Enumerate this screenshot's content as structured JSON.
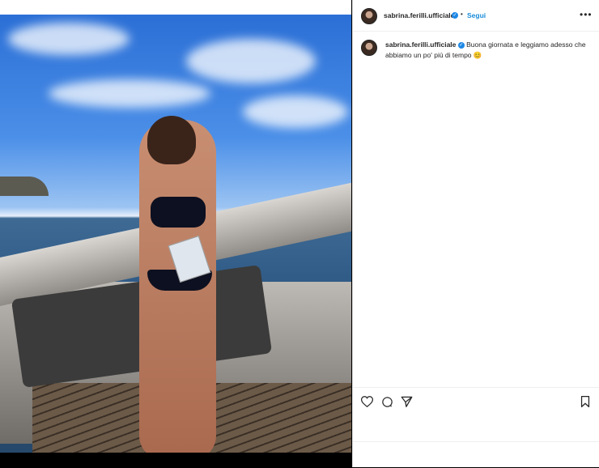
{
  "post": {
    "username": "sabrina.ferilli.ufficiale",
    "verified_mark": "✓",
    "dot": "•",
    "follow_label": "Segui",
    "more_label": "•••",
    "caption_user": "sabrina.ferilli.ufficiale",
    "caption_verified": "✓",
    "caption_line1": "Buona giornata e leggiamo adesso che",
    "caption_line2": "abbiamo un po' più di tempo 😊"
  },
  "icons": {
    "like": "heart-icon",
    "comment": "comment-icon",
    "share": "share-icon",
    "save": "bookmark-icon"
  },
  "colors": {
    "accent": "#1a8cd8",
    "verified": "#1e88e5"
  }
}
